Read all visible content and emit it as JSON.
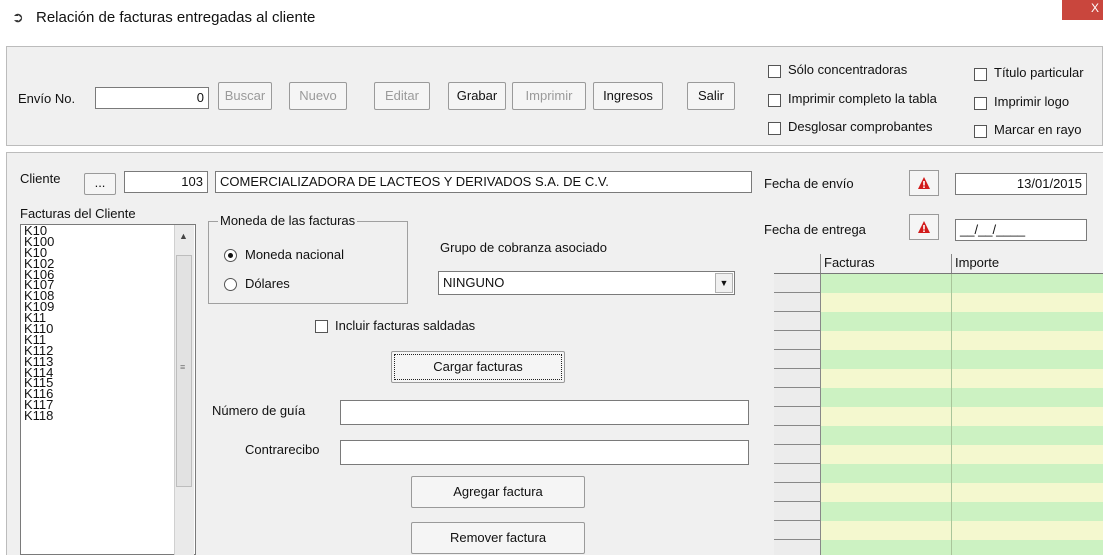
{
  "window": {
    "title": "Relación de facturas entregadas al cliente",
    "close_glyph": "X",
    "colors": {
      "close": "#c9463d",
      "panel": "#f0f0f0",
      "grid_even": "#ccf2c2",
      "grid_odd": "#f4f8cf",
      "alert": "#d21b1b"
    }
  },
  "toolbar": {
    "envio_label": "Envío No.",
    "envio_value": "0",
    "buttons": [
      "Buscar",
      "Nuevo",
      "Editar",
      "Grabar",
      "Imprimir",
      "Ingresos",
      "Salir"
    ],
    "options_col1": [
      "Sólo concentradoras",
      "Imprimir completo la tabla",
      "Desglosar comprobantes"
    ],
    "options_col2": [
      "Título particular",
      "Imprimir logo",
      "Marcar en rayo"
    ]
  },
  "cliente": {
    "label": "Cliente",
    "browse_label": "...",
    "id": "103",
    "name": "COMERCIALIZADORA DE LACTEOS Y DERIVADOS S.A. DE C.V."
  },
  "fechas": {
    "envio_label": "Fecha de envío",
    "envio_value": "13/01/2015",
    "entrega_label": "Fecha de entrega",
    "entrega_value": "__/__/____"
  },
  "facturas_cliente": {
    "label": "Facturas del Cliente",
    "items": [
      "K10",
      "K100",
      "K10",
      "K102",
      "K106",
      "K107",
      "K108",
      "K109",
      "K11",
      "K110",
      "K11",
      "K112",
      "K113",
      "K114",
      "K115",
      "K116",
      "K117",
      "K118"
    ]
  },
  "moneda": {
    "title": "Moneda de las facturas",
    "options": [
      "Moneda nacional",
      "Dólares"
    ]
  },
  "grupo": {
    "label": "Grupo de cobranza asociado",
    "value": "NINGUNO"
  },
  "incluir_saldadas_label": "Incluir facturas saldadas",
  "cargar_button": "Cargar facturas",
  "numero_guia_label": "Número de guía",
  "numero_guia_value": "",
  "contrarecibo_label": "Contrarecibo",
  "contrarecibo_value": "",
  "agregar_button": "Agregar factura",
  "remover_button": "Remover factura",
  "grid": {
    "headers": [
      "Facturas",
      "Importe"
    ]
  }
}
